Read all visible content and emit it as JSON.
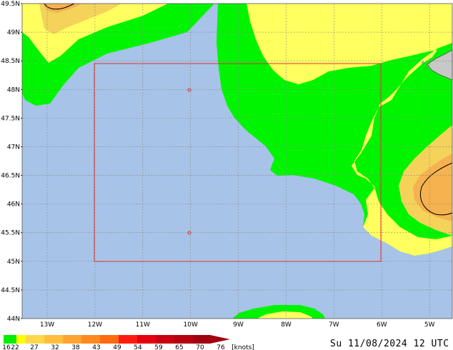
{
  "map": {
    "lat_labels": [
      "49.5N",
      "49N",
      "48.5N",
      "48N",
      "47.5N",
      "47N",
      "46.5N",
      "46N",
      "45.5N",
      "45N",
      "44.5N",
      "44N"
    ],
    "lon_labels": [
      "13W",
      "12W",
      "11W",
      "10W",
      "9W",
      "8W",
      "7W",
      "6W",
      "5W"
    ],
    "colors": {
      "sea": "#a7c3e8",
      "land": "#c8c8c8",
      "grid": "#8a8a8a",
      "box": "#e03030",
      "contour": "#000000",
      "wind_16": "#00f400",
      "wind_22": "#ffff60",
      "wind_27": "#f5d25a",
      "wind_32": "#f5b24e"
    }
  },
  "legend": {
    "labels": [
      "16",
      "22",
      "27",
      "32",
      "38",
      "43",
      "49",
      "54",
      "59",
      "65",
      "70",
      "76",
      "[knots]"
    ],
    "colors": [
      "#00ee00",
      "#ffff00",
      "#ffd84a",
      "#ffbe3c",
      "#ffa430",
      "#ff8a1e",
      "#ff6a10",
      "#ff1a10",
      "#e40010",
      "#c80010",
      "#b40010",
      "#a00010"
    ]
  },
  "timestamp": "Su 11/08/2024 12 UTC"
}
